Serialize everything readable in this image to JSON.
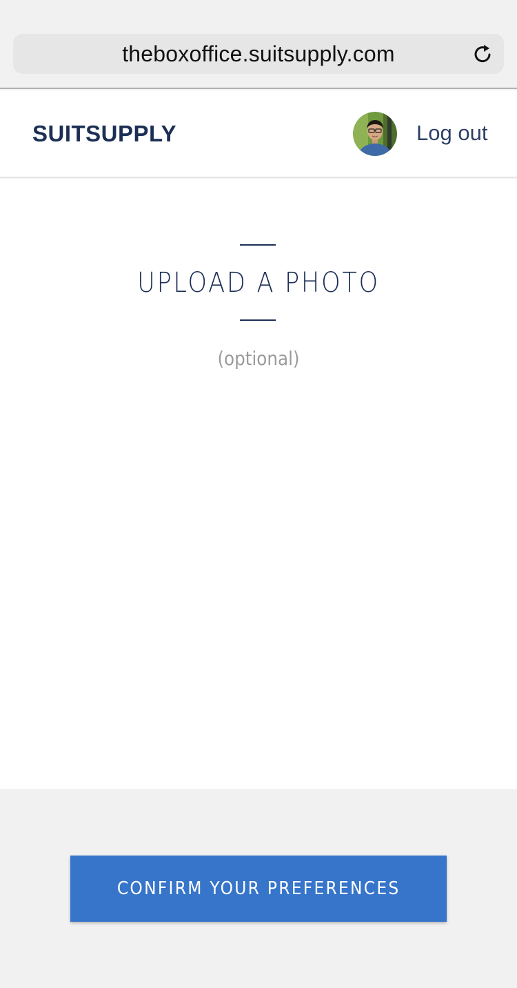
{
  "browser": {
    "url": "theboxoffice.suitsupply.com",
    "reload_icon": "reload-icon"
  },
  "header": {
    "brand": "SUITSUPPLY",
    "logout_label": "Log out",
    "avatar_icon": "user-avatar"
  },
  "main": {
    "title": "UPLOAD A PHOTO",
    "subtitle": "(optional)"
  },
  "footer": {
    "confirm_label": "CONFIRM YOUR PREFERENCES"
  },
  "colors": {
    "brand_navy": "#1c2f55",
    "button_blue": "#3675c9",
    "background_gray": "#f1f1f1"
  }
}
